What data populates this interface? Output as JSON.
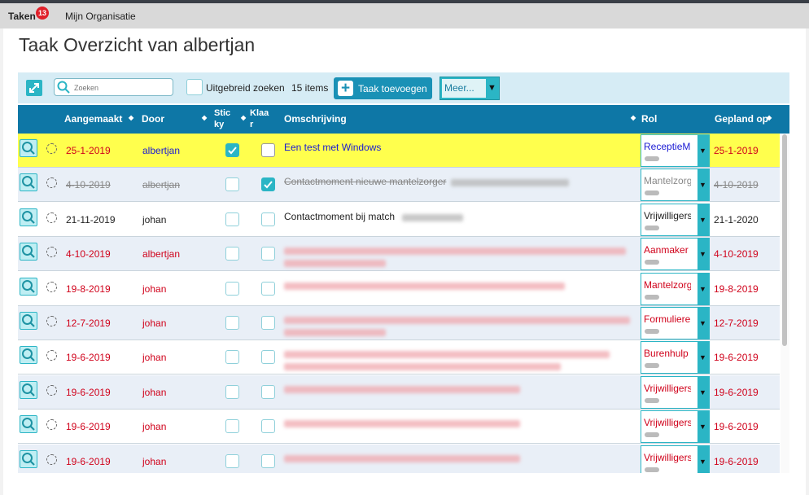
{
  "nav": {
    "tabs": [
      {
        "label": "Taken",
        "badge": "13"
      },
      {
        "label": "Mijn Organisatie"
      }
    ]
  },
  "page": {
    "title": "Taak Overzicht van albertjan"
  },
  "toolbar": {
    "search_placeholder": "Zoeken",
    "extended_search_label": "Uitgebreid zoeken",
    "item_count": "15 items",
    "add_task_label": "Taak toevoegen",
    "more_select_value": "Meer..."
  },
  "table": {
    "headers": {
      "aangemaakt": "Aangemaakt",
      "door": "Door",
      "sticky": "Stic ky",
      "klaar": "Klaa r",
      "omschrijving": "Omschrijving",
      "rol": "Rol",
      "gepland": "Gepland op"
    },
    "rows": [
      {
        "aangemaakt": "25-1-2019",
        "door": "albertjan",
        "sticky": true,
        "klaar": false,
        "omschrijving": "Een test met Windows",
        "rol": "ReceptieM",
        "gepland": "25-1-2019"
      },
      {
        "aangemaakt": "4-10-2019",
        "door": "albertjan",
        "sticky": false,
        "klaar": true,
        "omschrijving": "Contactmoment nieuwe mantelzorger",
        "rol": "Mantelzorg",
        "gepland": "4-10-2019"
      },
      {
        "aangemaakt": "21-11-2019",
        "door": "johan",
        "sticky": false,
        "klaar": false,
        "omschrijving": "Contactmoment bij match",
        "rol": "Vrijwilligers",
        "gepland": "21-1-2020"
      },
      {
        "aangemaakt": "4-10-2019",
        "door": "albertjan",
        "sticky": false,
        "klaar": false,
        "omschrijving": "",
        "rol": "Aanmaker",
        "gepland": "4-10-2019"
      },
      {
        "aangemaakt": "19-8-2019",
        "door": "johan",
        "sticky": false,
        "klaar": false,
        "omschrijving": "",
        "rol": "Mantelzorg",
        "gepland": "19-8-2019"
      },
      {
        "aangemaakt": "12-7-2019",
        "door": "johan",
        "sticky": false,
        "klaar": false,
        "omschrijving": "",
        "rol": "Formuliere",
        "gepland": "12-7-2019"
      },
      {
        "aangemaakt": "19-6-2019",
        "door": "johan",
        "sticky": false,
        "klaar": false,
        "omschrijving": "",
        "rol": "Burenhulp",
        "gepland": "19-6-2019"
      },
      {
        "aangemaakt": "19-6-2019",
        "door": "johan",
        "sticky": false,
        "klaar": false,
        "omschrijving": "",
        "rol": "Vrijwilligers",
        "gepland": "19-6-2019"
      },
      {
        "aangemaakt": "19-6-2019",
        "door": "johan",
        "sticky": false,
        "klaar": false,
        "omschrijving": "",
        "rol": "Vrijwilligers",
        "gepland": "19-6-2019"
      },
      {
        "aangemaakt": "19-6-2019",
        "door": "johan",
        "sticky": false,
        "klaar": false,
        "omschrijving": "",
        "rol": "Vrijwilligers",
        "gepland": "19-6-2019"
      }
    ]
  },
  "colors": {
    "header_bg": "#0e77a6",
    "accent": "#2bb5c5",
    "highlight_row": "#ffff4d",
    "overdue_text": "#d0021b",
    "link_text": "#1a1ad4",
    "badge": "#e0202a"
  },
  "icons": {
    "expand": "expand-arrows-icon",
    "search": "magnifier-icon",
    "add": "plus-icon",
    "row_open": "magnifier-icon",
    "row_status": "dashed-circle-icon",
    "dropdown": "triangle-down-icon",
    "sort": "sort-arrows-icon"
  }
}
